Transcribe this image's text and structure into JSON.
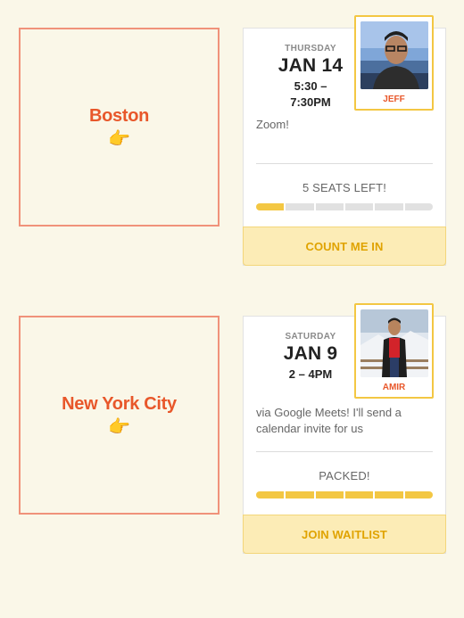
{
  "events": [
    {
      "city": "Boston",
      "pointer_icon": "👉",
      "weekday": "THURSDAY",
      "date": "JAN 14",
      "time": "5:30 –\n7:30PM",
      "host_name": "JEFF",
      "location": "Zoom!",
      "seats_text": "5 SEATS LEFT!",
      "seats_filled": 1,
      "seats_total": 6,
      "cta_label": "COUNT ME IN"
    },
    {
      "city": "New York City",
      "pointer_icon": "👉",
      "weekday": "SATURDAY",
      "date": "JAN 9",
      "time": "2 – 4PM",
      "host_name": "AMIR",
      "location": "via Google Meets! I'll send a calendar invite for us",
      "seats_text": "PACKED!",
      "seats_filled": 6,
      "seats_total": 6,
      "cta_label": "JOIN WAITLIST"
    }
  ],
  "colors": {
    "background": "#faf7e8",
    "accent_orange": "#e8572a",
    "accent_yellow": "#f3c743",
    "cta_bg": "#fcecb6"
  }
}
